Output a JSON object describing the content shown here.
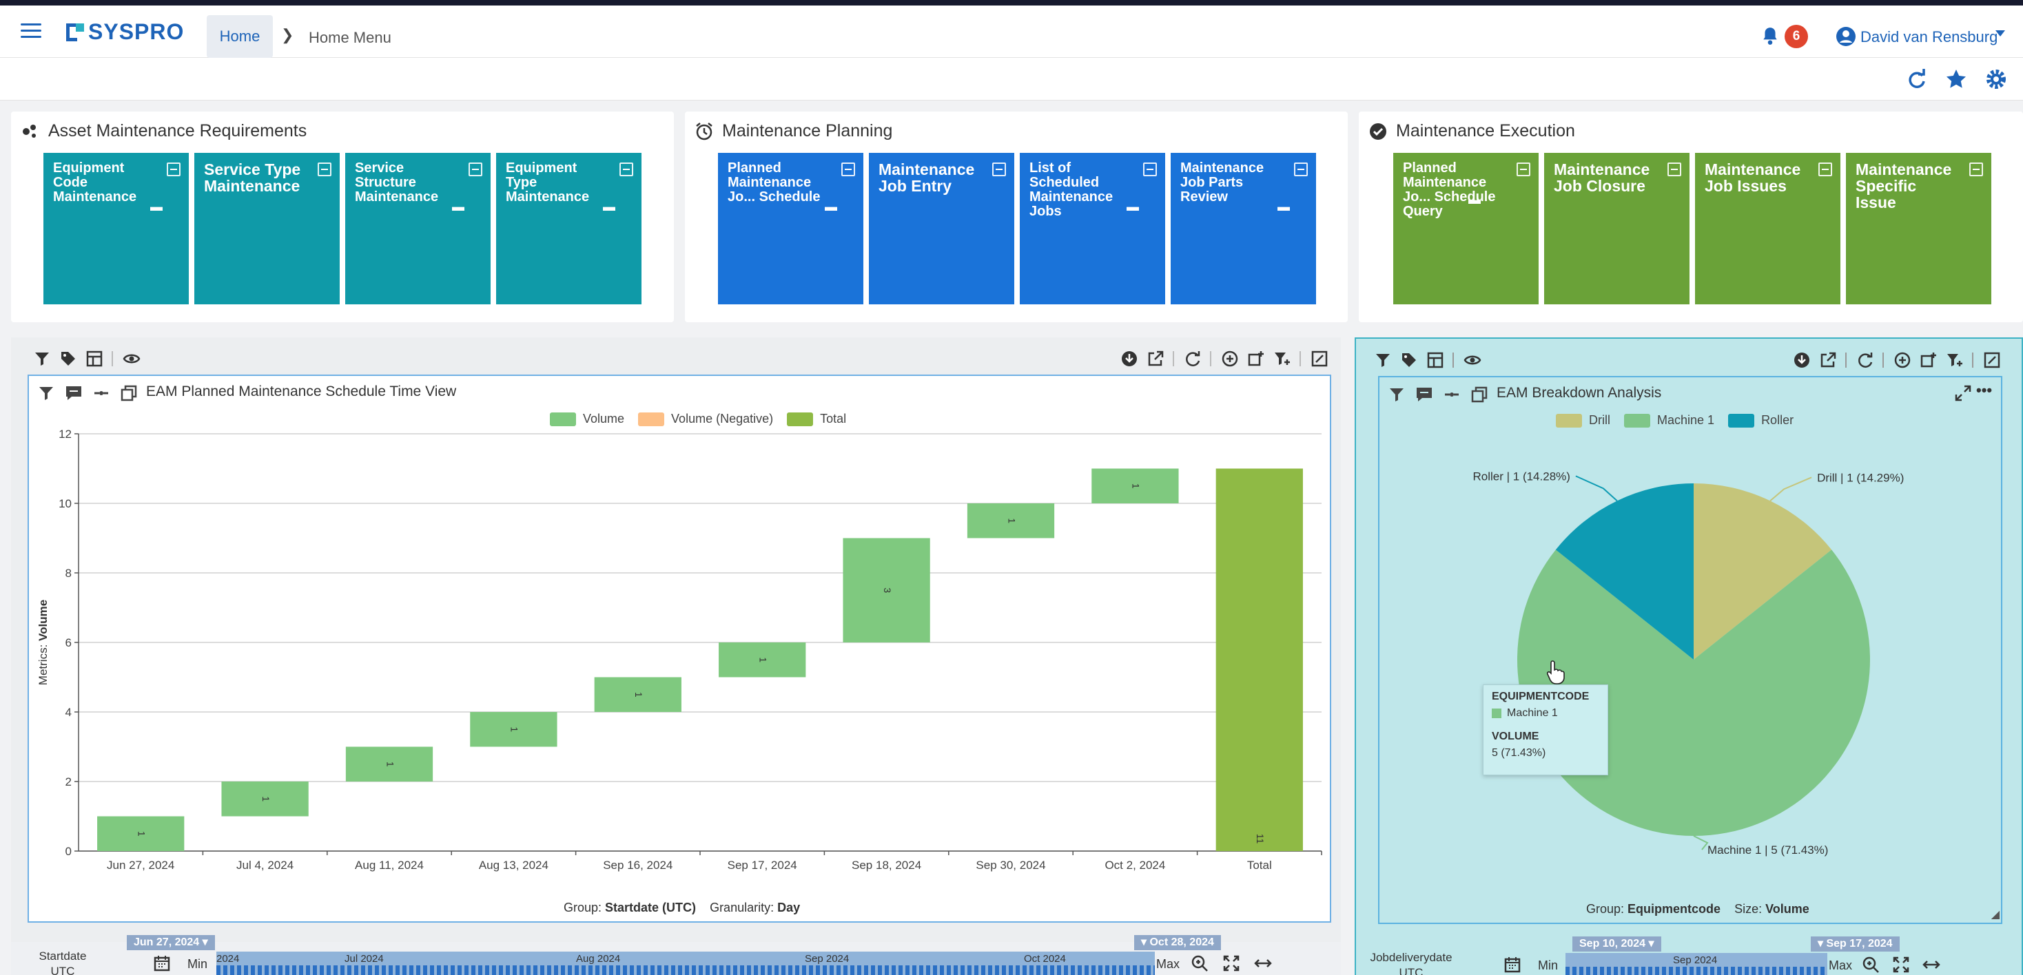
{
  "header": {
    "logo_text": "SYSPRO",
    "breadcrumb_home": "Home",
    "breadcrumb_current": "Home Menu",
    "notification_count": "6",
    "user_name": "David van Rensburg"
  },
  "panels": [
    {
      "title": "Asset Maintenance Requirements",
      "color": "#0f9aa8",
      "tiles": [
        "Equipment Code Maintenance",
        "Service Type Maintenance",
        "Service Structure Maintenance",
        "Equipment Type Maintenance"
      ]
    },
    {
      "title": "Maintenance Planning",
      "color": "#1a73d9",
      "tiles": [
        "Planned Maintenance Jo... Schedule",
        "Maintenance Job Entry",
        "List of Scheduled Maintenance Jobs",
        "Maintenance Job Parts Review"
      ]
    },
    {
      "title": "Maintenance Execution",
      "color": "#6aa238",
      "tiles": [
        "Planned Maintenance Jo... Schedule Query",
        "Maintenance Job Closure",
        "Maintenance Job Issues",
        "Maintenance Specific Issue"
      ]
    }
  ],
  "waterfall": {
    "title": "EAM Planned Maintenance Schedule Time View",
    "legend": [
      "Volume",
      "Volume (Negative)",
      "Total"
    ],
    "colors": {
      "volume": "#7fc97f",
      "negative": "#fdbf86",
      "total": "#8fba45"
    },
    "ylabel_prefix": "Metrics: ",
    "ylabel_value": "Volume",
    "group_label": "Group: ",
    "group_value": "Startdate (UTC)",
    "granularity_label": "Granularity: ",
    "granularity_value": "Day",
    "slider": {
      "label": "Startdate UTC",
      "start_flag": "Jun 27, 2024",
      "end_flag": "Oct 28, 2024",
      "ticks": [
        "2024",
        "Jul 2024",
        "Aug 2024",
        "Sep 2024",
        "Oct 2024"
      ],
      "min": "Min",
      "max": "Max"
    }
  },
  "pie": {
    "title": "EAM Breakdown Analysis",
    "legend": [
      "Drill",
      "Machine 1",
      "Roller"
    ],
    "labels": [
      "Drill | 1 (14.29%)",
      "Machine 1 | 5 (71.43%)",
      "Roller | 1 (14.28%)"
    ],
    "group_label": "Group: ",
    "group_value": "Equipmentcode",
    "size_label": "Size: ",
    "size_value": "Volume",
    "tooltip": {
      "h1": "EQUIPMENTCODE",
      "v1": "Machine 1",
      "h2": "VOLUME",
      "v2": "5 (71.43%)"
    },
    "slider": {
      "label": "Jobdeliverydate UTC",
      "start_flag": "Sep 10, 2024",
      "end_flag": "Sep 17, 2024",
      "ticks": [
        "Sep 2024"
      ],
      "min": "Min",
      "max": "Max"
    }
  },
  "chart_data": [
    {
      "type": "bar",
      "chart_subtype": "waterfall",
      "title": "EAM Planned Maintenance Schedule Time View",
      "categories": [
        "Jun 27, 2024",
        "Jul 4, 2024",
        "Aug 11, 2024",
        "Aug 13, 2024",
        "Sep 16, 2024",
        "Sep 17, 2024",
        "Sep 18, 2024",
        "Sep 30, 2024",
        "Oct 2, 2024",
        "Total"
      ],
      "series": [
        {
          "name": "Volume",
          "values": [
            1,
            1,
            1,
            1,
            1,
            1,
            3,
            1,
            1,
            11
          ]
        }
      ],
      "data_labels": [
        "1",
        "1",
        "1",
        "1",
        "1",
        "1",
        "3",
        "1",
        "1",
        "11"
      ],
      "ylabel": "Metrics: Volume",
      "ylim": [
        0,
        12
      ],
      "yticks": [
        0,
        2,
        4,
        6,
        8,
        10,
        12
      ],
      "grid": true,
      "legend_position": "top-center"
    },
    {
      "type": "pie",
      "title": "EAM Breakdown Analysis",
      "categories": [
        "Drill",
        "Machine 1",
        "Roller"
      ],
      "values": [
        1,
        5,
        1
      ],
      "percentages": [
        14.29,
        71.43,
        14.28
      ],
      "colors": [
        "#c5c57a",
        "#7fc689",
        "#0e9bb3"
      ],
      "legend_position": "top-center"
    }
  ]
}
